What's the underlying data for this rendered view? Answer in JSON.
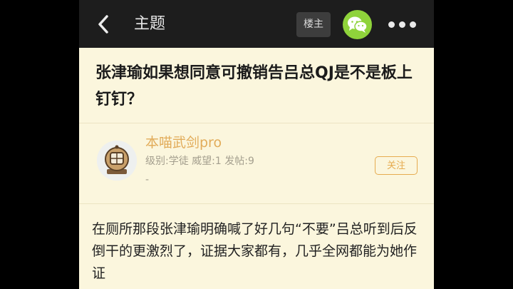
{
  "header": {
    "title": "主题",
    "owner_label": "楼主"
  },
  "post": {
    "title": "张津瑜如果想同意可撤销告吕总QJ是不是板上钉钉？",
    "author": {
      "name": "本喵武剑pro",
      "meta": "级别:学徒  威望:1  发帖:9",
      "extra": "-",
      "follow_label": "关注"
    },
    "body": "在厕所那段张津瑜明确喊了好几句“不要”吕总听到后反倒干的更激烈了，证据大家都有，几乎全网都能为她作证"
  },
  "colors": {
    "topbar": "#1d1d1d",
    "page_bg": "#fbf6dd",
    "username": "#e2ac5a",
    "follow": "#e6ab4f",
    "wechat": "#8fd33b"
  },
  "icons": {
    "back": "chevron-left-icon",
    "share": "wechat-icon",
    "more": "more-dots-icon",
    "avatar": "diving-helmet-avatar"
  }
}
